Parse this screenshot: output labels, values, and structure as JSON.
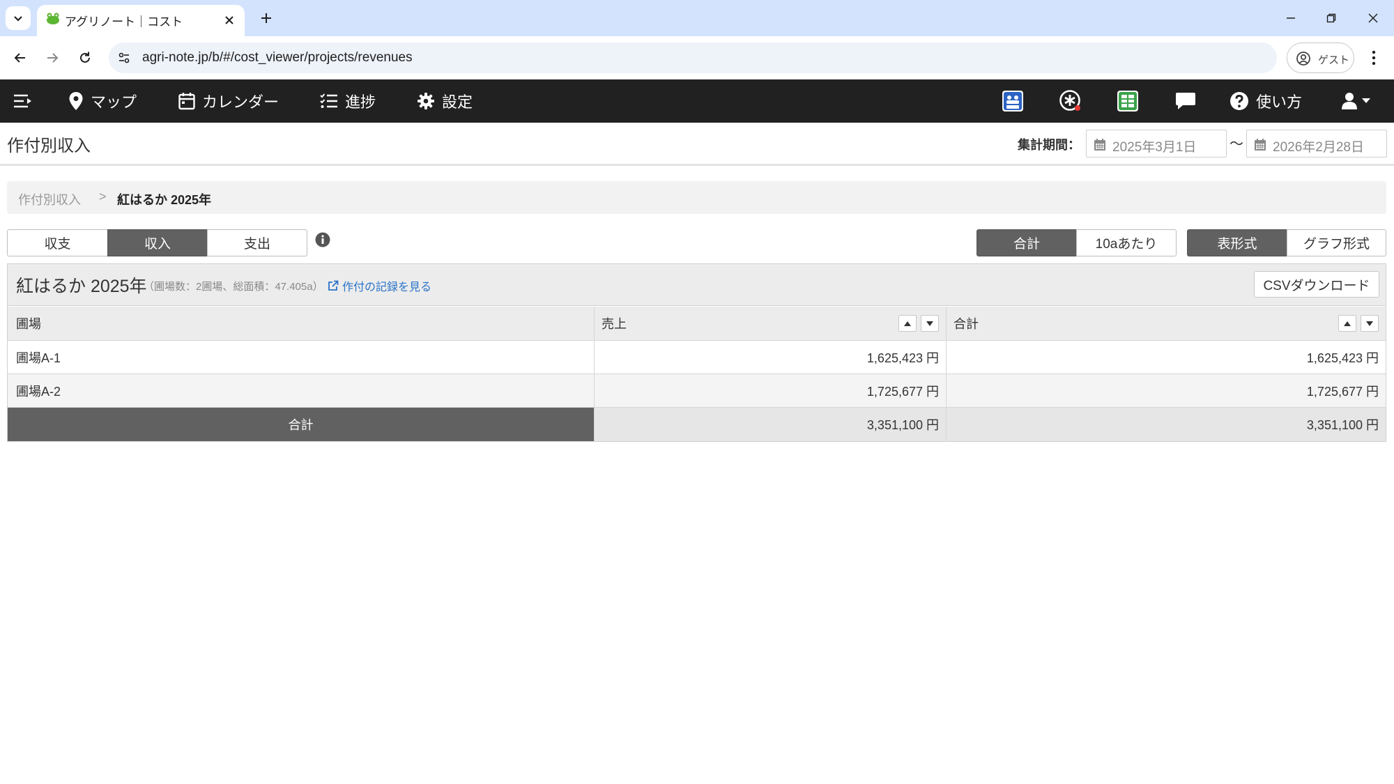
{
  "browser": {
    "tab_title": "アグリノート｜コスト",
    "url": "agri-note.jp/b/#/cost_viewer/projects/revenues",
    "profile_label": "ゲスト"
  },
  "appnav": {
    "items": [
      {
        "label": "マップ",
        "icon": "map-pin-icon"
      },
      {
        "label": "カレンダー",
        "icon": "calendar-icon"
      },
      {
        "label": "進捗",
        "icon": "list-icon"
      },
      {
        "label": "設定",
        "icon": "gear-icon"
      }
    ],
    "help_label": "使い方"
  },
  "header": {
    "title": "作付別収入",
    "period_label": "集計期間：",
    "start_date": "2025年3月1日",
    "end_date": "2026年2月28日",
    "separator": "〜"
  },
  "breadcrumb": {
    "parent": "作付別収入",
    "separator": ">",
    "current": "紅はるか 2025年"
  },
  "view_tabs": {
    "balance": "収支",
    "income": "収入",
    "expense": "支出",
    "active": "収入"
  },
  "toggles": {
    "total": "合計",
    "per_10a": "10aあたり",
    "table": "表形式",
    "graph": "グラフ形式"
  },
  "panel": {
    "title": "紅はるか 2025年",
    "meta": "（圃場数：2圃場、総面積：47.405a）",
    "link": "作付の記録を見る",
    "csv_button": "CSVダウンロード"
  },
  "table": {
    "headers": [
      "圃場",
      "売上",
      "合計"
    ],
    "rows": [
      {
        "field": "圃場A-1",
        "sales": "1,625,423 円",
        "total": "1,625,423 円"
      },
      {
        "field": "圃場A-2",
        "sales": "1,725,677 円",
        "total": "1,725,677 円"
      }
    ],
    "total_row": {
      "label": "合計",
      "sales": "3,351,100 円",
      "total": "3,351,100 円"
    }
  },
  "colors": {
    "navbar": "#212121",
    "active_segment": "#616161",
    "link": "#2a73c9",
    "tabbar": "#d3e3fd"
  }
}
